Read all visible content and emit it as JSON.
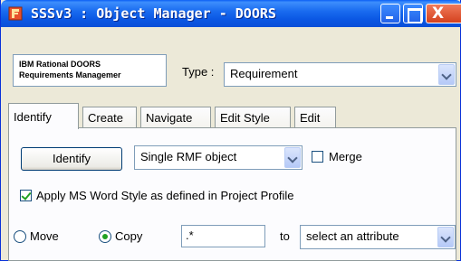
{
  "window": {
    "title": "SSSv3 : Object Manager - DOORS",
    "close_glyph": "X"
  },
  "logo": {
    "line1": "IBM Rational DOORS",
    "line2": "Requirements Managemer"
  },
  "type_field": {
    "label": "Type :",
    "value": "Requirement"
  },
  "tabs": [
    {
      "label": "Identify",
      "active": true
    },
    {
      "label": "Create",
      "active": false
    },
    {
      "label": "Navigate",
      "active": false
    },
    {
      "label": "Edit Style",
      "active": false
    },
    {
      "label": "Edit",
      "active": false
    }
  ],
  "identify_panel": {
    "identify_button": "Identify",
    "mode_select": "Single RMF object",
    "merge_label": "Merge",
    "merge_checked": false,
    "apply_style_label": "Apply MS Word Style as defined in Project Profile",
    "apply_style_checked": true
  },
  "bottom_row": {
    "move_label": "Move",
    "move_selected": false,
    "copy_label": "Copy",
    "copy_selected": true,
    "pattern_value": ".*",
    "to_label": "to",
    "attribute_select": "select an attribute"
  },
  "colors": {
    "titlebar": "#0b58e4",
    "close_button": "#d4411e",
    "face": "#ece9d8",
    "check": "#21a121"
  },
  "icons": [
    "app-icon",
    "minimize-icon",
    "maximize-icon",
    "close-icon",
    "chevron-down-icon"
  ]
}
